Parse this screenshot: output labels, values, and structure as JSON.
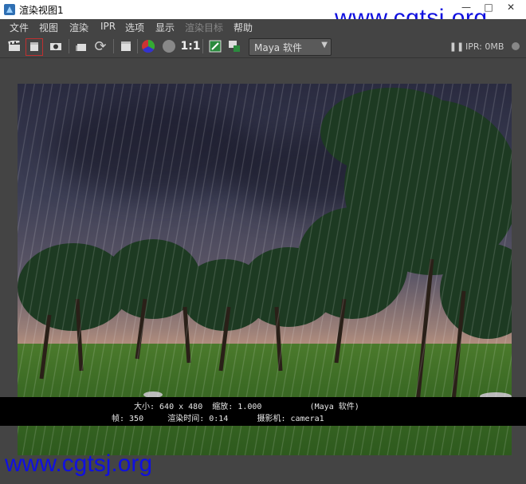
{
  "window": {
    "title": "渲染视图1",
    "controls": [
      "—",
      "□",
      "✕"
    ]
  },
  "watermark": {
    "top": "www.cgtsj.org",
    "bottom": "www.cgtsj.org"
  },
  "menu": [
    {
      "label": "文件"
    },
    {
      "label": "视图"
    },
    {
      "label": "渲染"
    },
    {
      "label": "IPR"
    },
    {
      "label": "选项"
    },
    {
      "label": "显示"
    },
    {
      "label": "渲染目标"
    },
    {
      "label": "帮助"
    }
  ],
  "toolbar": {
    "ratio_label": "1:1",
    "renderer_select": "Maya 软件",
    "ipr_status": "IPR: 0MB"
  },
  "info": {
    "line1": "大小: 640 x 480  缩放: 1.000          (Maya 软件)",
    "line2": "帧: 350     渲染时间: 0:14      摄影机: camera1"
  },
  "colors": {
    "menu_disabled": "#888888",
    "watermark": "#1010e0"
  }
}
